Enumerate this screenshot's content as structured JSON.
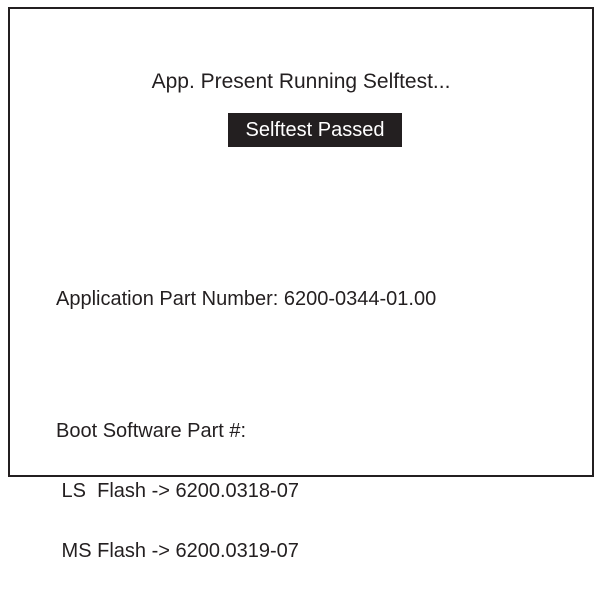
{
  "selftest": {
    "status_line": "App. Present Running Selftest...",
    "result_badge": "Selftest Passed"
  },
  "application": {
    "part_number_line": "Application Part Number: 6200-0344-01.00"
  },
  "boot_software": {
    "header": "Boot Software Part #:",
    "ls_flash": " LS  Flash -> 6200.0318-07",
    "ms_flash": " MS Flash -> 6200.0319-07"
  },
  "colors": {
    "foreground": "#231f20",
    "background": "#ffffff"
  }
}
